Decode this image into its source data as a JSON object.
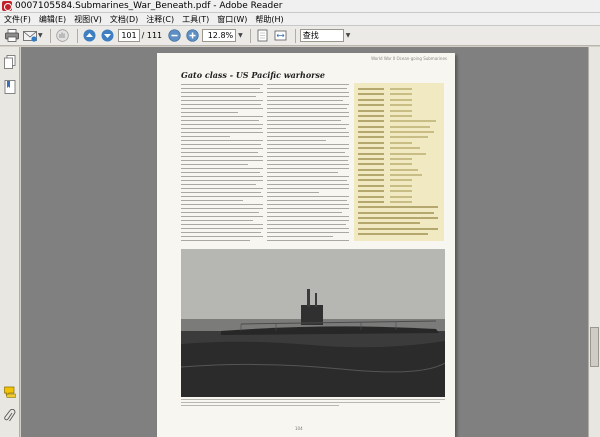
{
  "window": {
    "title": "0007105584.Submarines_War_Beneath.pdf - Adobe Reader"
  },
  "menu": {
    "items": [
      {
        "label": "文件(F)"
      },
      {
        "label": "编辑(E)"
      },
      {
        "label": "视图(V)"
      },
      {
        "label": "文档(D)"
      },
      {
        "label": "注释(C)"
      },
      {
        "label": "工具(T)"
      },
      {
        "label": "窗口(W)"
      },
      {
        "label": "帮助(H)"
      }
    ]
  },
  "toolbar": {
    "page_current": "101",
    "page_total": "/ 111",
    "zoom_value": "12.8%",
    "search_placeholder": "查找"
  },
  "page": {
    "header": "World War II Ocean-going Submarines",
    "title": "Gato class - US Pacific warhorse",
    "page_number": "104"
  },
  "colors": {
    "titlebar_bg": "#f0f0f0",
    "toolbar_bg": "#eceae6",
    "doc_area_bg": "#808080",
    "page_bg": "#f7f6f1",
    "sidebox_bg": "#f1e9c2"
  }
}
